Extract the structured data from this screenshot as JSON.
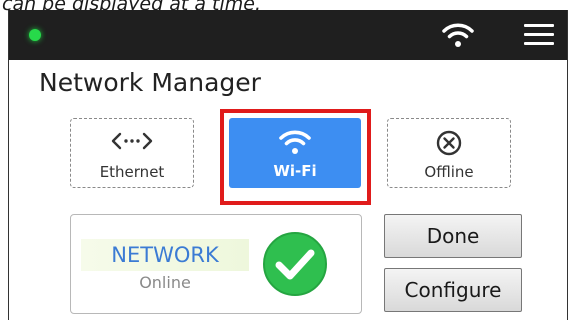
{
  "caption": "can be displayed at a time.",
  "status_bar": {
    "led_color": "#27d94a",
    "wifi_icon": "wifi-icon",
    "menu_icon": "hamburger-menu-icon"
  },
  "title": "Network Manager",
  "modes": [
    {
      "label": "Ethernet",
      "icon": "ethernet-icon",
      "selected": false
    },
    {
      "label": "Wi-Fi",
      "icon": "wifi-icon",
      "selected": true
    },
    {
      "label": "Offline",
      "icon": "offline-icon",
      "selected": false
    }
  ],
  "selection_highlight_color": "#e01b1b",
  "accent_color": "#3d8ef2",
  "network": {
    "title": "NETWORK",
    "status": "Online",
    "status_icon": "check-circle-icon",
    "status_color": "#2fbf4f"
  },
  "buttons": {
    "done_label": "Done",
    "configure_label": "Configure"
  }
}
